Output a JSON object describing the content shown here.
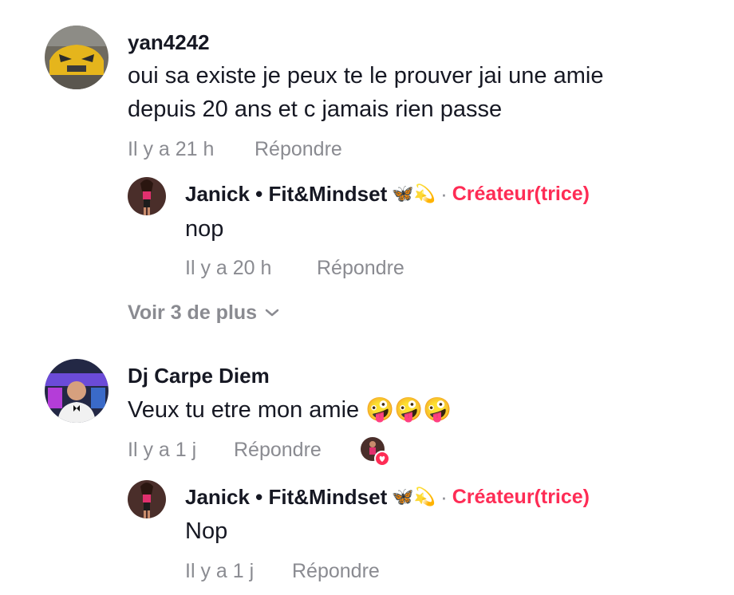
{
  "comments": [
    {
      "username": "yan4242",
      "text_line1": "oui sa existe je peux te le prouver jai une amie",
      "text_line2": "depuis 20 ans et c jamais rien passe",
      "time": "Il y a 21 h",
      "reply_label": "Répondre",
      "reply": {
        "name": "Janick • Fit&Mindset",
        "emoji": "🦋💫",
        "separator": "·",
        "badge": "Créateur(trice)",
        "text": "nop",
        "time": "Il y a 20 h",
        "reply_label": "Répondre"
      },
      "more_label": "Voir 3 de plus"
    },
    {
      "username": "Dj Carpe Diem",
      "text": "Veux tu etre mon amie 🤪🤪🤪",
      "time": "Il y a 1 j",
      "reply_label": "Répondre",
      "reply": {
        "name": "Janick • Fit&Mindset",
        "emoji": "🦋💫",
        "separator": "·",
        "badge": "Créateur(trice)",
        "text": "Nop",
        "time": "Il y a 1 j",
        "reply_label": "Répondre"
      }
    }
  ],
  "colors": {
    "creator_badge": "#fe2c55",
    "meta_text": "#8a8b91",
    "primary_text": "#161823"
  }
}
